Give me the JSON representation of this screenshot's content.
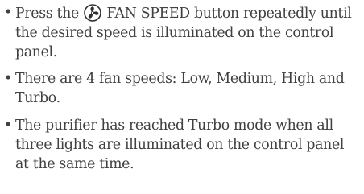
{
  "bullet_char": "•",
  "items": [
    {
      "before_icon": "Press the ",
      "icon": "fan-icon",
      "after_icon": " FAN SPEED button repeatedly until the desired speed is illuminated on the control panel."
    },
    {
      "text": "There are 4 fan speeds: Low, Medium, High and Turbo."
    },
    {
      "text": "The purifier has reached Turbo mode when all three lights are illuminated on the control panel at the same time."
    }
  ]
}
